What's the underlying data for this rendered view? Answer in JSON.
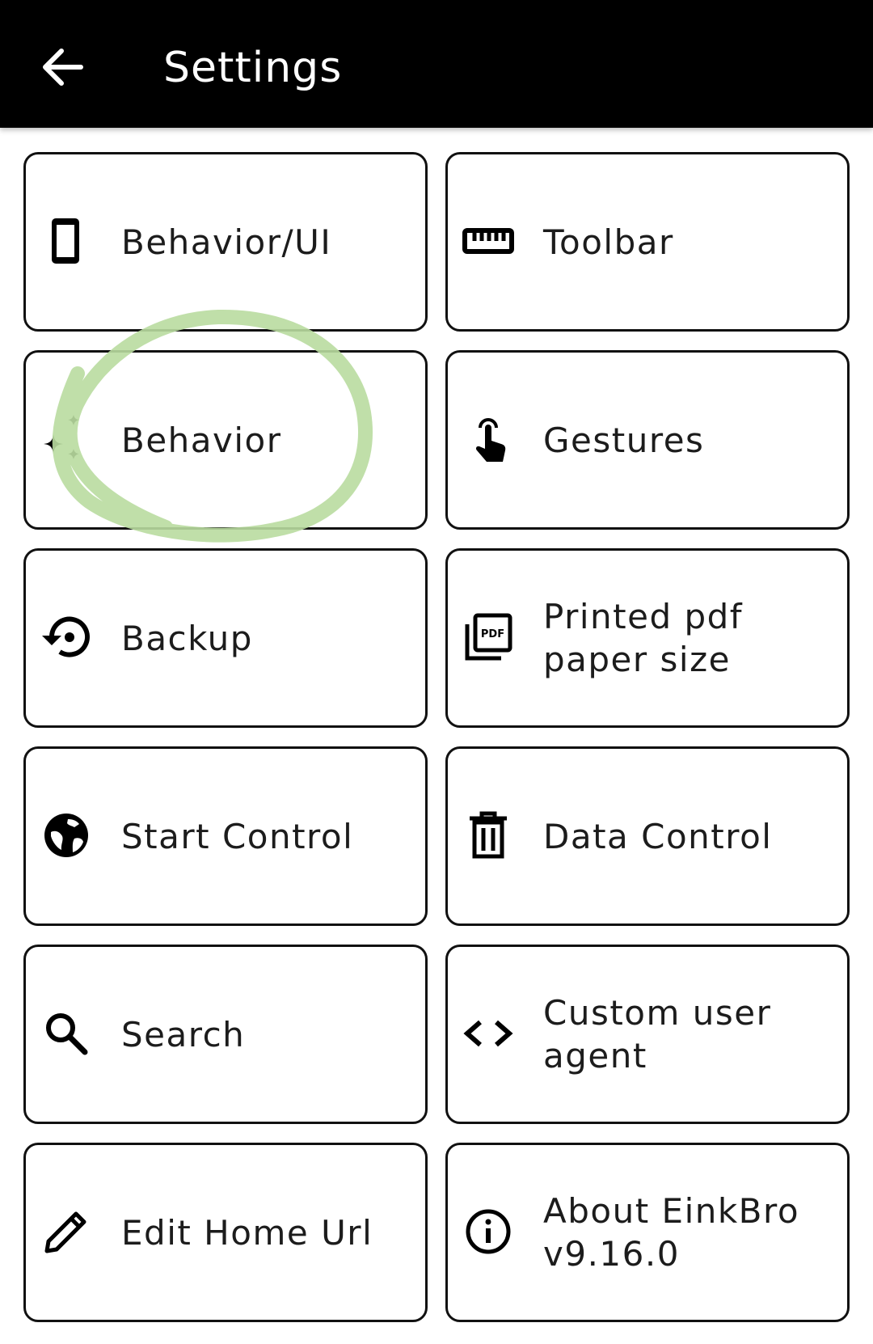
{
  "header": {
    "title": "Settings",
    "back_icon": "arrow-back-icon"
  },
  "menu": [
    {
      "id": "behavior-ui",
      "label": "Behavior/UI",
      "icon": "phone-icon"
    },
    {
      "id": "toolbar",
      "label": "Toolbar",
      "icon": "ruler-icon"
    },
    {
      "id": "behavior",
      "label": "Behavior",
      "icon": "sparkle-icon"
    },
    {
      "id": "gestures",
      "label": "Gestures",
      "icon": "touch-icon"
    },
    {
      "id": "backup",
      "label": "Backup",
      "icon": "restore-icon"
    },
    {
      "id": "printed-pdf-paper-size",
      "label": "Printed pdf paper size",
      "icon": "pdf-icon"
    },
    {
      "id": "start-control",
      "label": "Start Control",
      "icon": "globe-icon"
    },
    {
      "id": "data-control",
      "label": "Data Control",
      "icon": "trash-icon"
    },
    {
      "id": "search",
      "label": "Search",
      "icon": "search-icon"
    },
    {
      "id": "custom-user-agent",
      "label": "Custom user agent",
      "icon": "code-icon"
    },
    {
      "id": "edit-home-url",
      "label": "Edit Home Url",
      "icon": "pencil-icon"
    },
    {
      "id": "about",
      "label": "About EinkBro v9.16.0",
      "icon": "info-icon"
    }
  ],
  "colors": {
    "header_bg": "#000000",
    "tile_border": "#111111",
    "annotation_stroke": "#b9dba0"
  }
}
